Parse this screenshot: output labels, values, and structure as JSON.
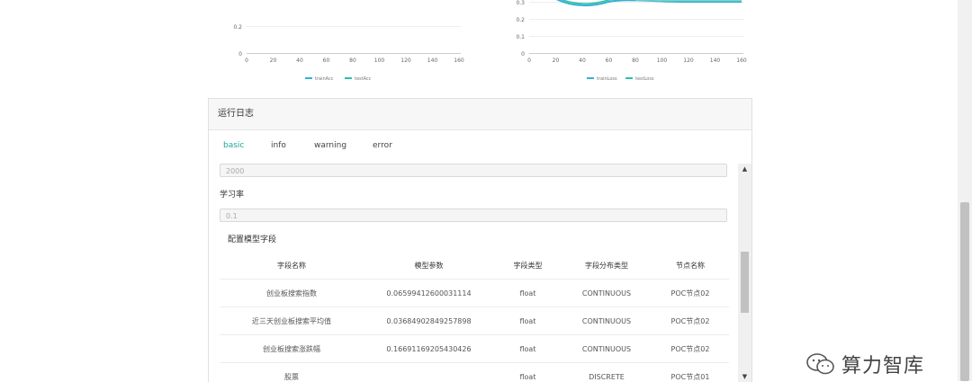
{
  "charts": [
    {
      "y_ticks": [
        "0.2",
        "0"
      ],
      "x_ticks": [
        "0",
        "20",
        "40",
        "60",
        "80",
        "100",
        "120",
        "140",
        "160"
      ],
      "legend": [
        "trainAcc",
        "testAcc"
      ],
      "colors": [
        "#35b1d0",
        "#2cc0a5"
      ]
    },
    {
      "y_ticks": [
        "0.3",
        "0.2",
        "0.1",
        "0"
      ],
      "x_ticks": [
        "0",
        "20",
        "40",
        "60",
        "80",
        "100",
        "120",
        "140",
        "160"
      ],
      "legend": [
        "trainLoss",
        "testLoss"
      ],
      "colors": [
        "#35b1d0",
        "#2cc0a5"
      ]
    }
  ],
  "panel": {
    "title": "运行日志",
    "tabs": [
      {
        "label": "basic",
        "active": true
      },
      {
        "label": "info",
        "active": false
      },
      {
        "label": "warning",
        "active": false
      },
      {
        "label": "error",
        "active": false
      }
    ],
    "field_top_value": "2000",
    "learning_rate_label": "学习率",
    "learning_rate_value": "0.1",
    "section_title": "配置模型字段",
    "table": {
      "headers": [
        "字段名称",
        "模型参数",
        "字段类型",
        "字段分布类型",
        "节点名称"
      ],
      "rows": [
        [
          "创业板搜索指数",
          "0.06599412600031114",
          "float",
          "CONTINUOUS",
          "POC节点02"
        ],
        [
          "近三天创业板搜索平均值",
          "0.03684902849257898",
          "float",
          "CONTINUOUS",
          "POC节点02"
        ],
        [
          "创业板搜索涨跌幅",
          "0.16691169205430426",
          "float",
          "CONTINUOUS",
          "POC节点02"
        ],
        [
          "股票",
          "",
          "float",
          "DISCRETE",
          "POC节点01"
        ]
      ]
    }
  },
  "watermark": {
    "text": "算力智库",
    "icon": "wechat-icon"
  },
  "accent_color": "#1aa89c"
}
